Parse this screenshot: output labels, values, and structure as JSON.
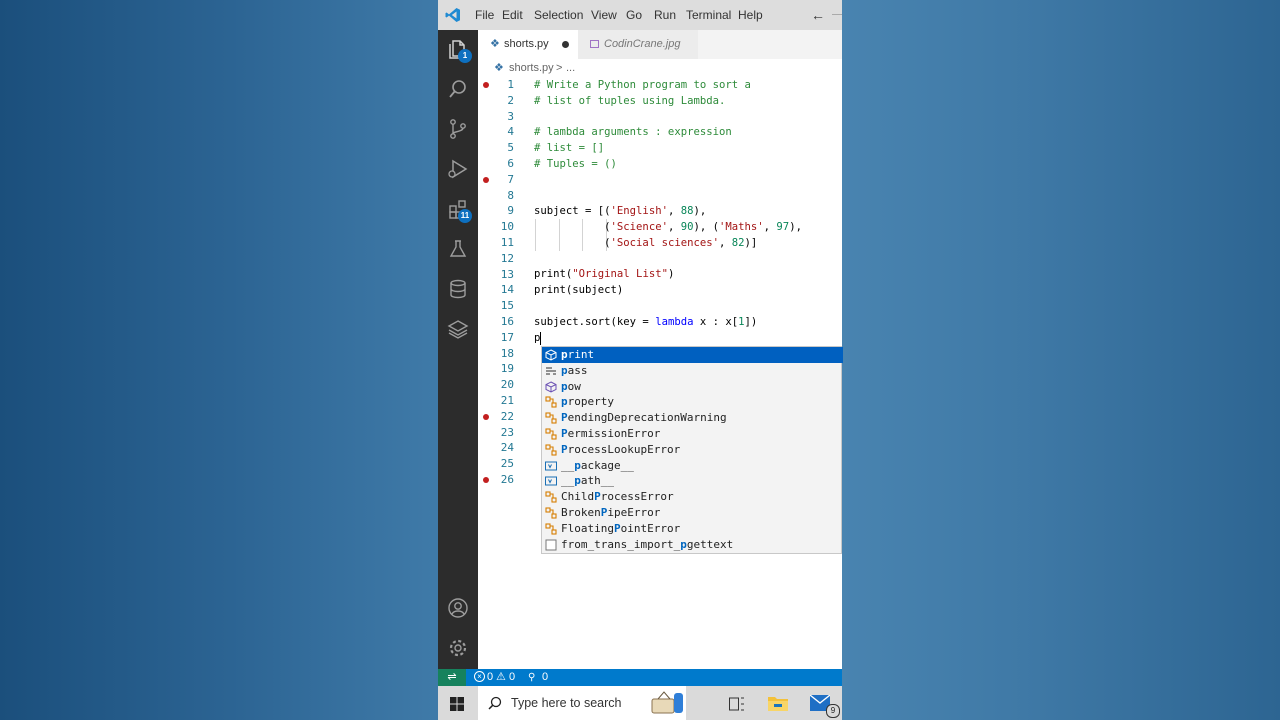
{
  "menu": {
    "items": [
      "File",
      "Edit",
      "Selection",
      "View",
      "Go",
      "Run",
      "Terminal",
      "Help"
    ],
    "back_arrow": "←"
  },
  "activity_bar": {
    "explorer_badge": "1",
    "extensions_badge": "11",
    "icons": [
      "files-icon",
      "search-icon",
      "source-control-icon",
      "run-debug-icon",
      "extensions-icon",
      "testing-icon",
      "database-icon",
      "layers-icon",
      "account-icon",
      "settings-gear-icon"
    ]
  },
  "tabs": [
    {
      "label": "shorts.py",
      "active": true,
      "modified": true
    },
    {
      "label": "CodinCrane.jpg",
      "active": false,
      "modified": false
    }
  ],
  "breadcrumb": {
    "file": "shorts.py",
    "sep": ">",
    "rest": "..."
  },
  "editor": {
    "line_numbers": [
      "1",
      "2",
      "3",
      "4",
      "5",
      "6",
      "7",
      "8",
      "9",
      "10",
      "11",
      "12",
      "13",
      "14",
      "15",
      "16",
      "17",
      "18",
      "19",
      "20",
      "21",
      "22",
      "23",
      "24",
      "25",
      "26"
    ],
    "breakpoint_lines": [
      1,
      7,
      22,
      26
    ],
    "code": {
      "l1": "# Write a Python program to sort a",
      "l2": "# list of tuples using Lambda.",
      "l4": "# lambda arguments : expression",
      "l5": "# list = []",
      "l6": "# Tuples = ()",
      "l9": [
        "subject = [(",
        "'English'",
        ", ",
        "88",
        "),"
      ],
      "l10": [
        "           (",
        "'Science'",
        ", ",
        "90",
        "), (",
        "'Maths'",
        ", ",
        "97",
        "),"
      ],
      "l11": [
        "           (",
        "'Social sciences'",
        ", ",
        "82",
        ")]"
      ],
      "l13": [
        "print(",
        "\"Original List\"",
        ")"
      ],
      "l14": "print(subject)",
      "l16": [
        "subject.sort(key = ",
        "lambda",
        " x : x[",
        "1",
        "])"
      ],
      "l17": "p"
    }
  },
  "suggestions": [
    {
      "pre": "",
      "hl": "p",
      "post": "rint",
      "icon": "cube-icon",
      "selected": true
    },
    {
      "pre": "",
      "hl": "p",
      "post": "ass",
      "icon": "keyword-icon",
      "selected": false
    },
    {
      "pre": "",
      "hl": "p",
      "post": "ow",
      "icon": "cube-icon",
      "selected": false
    },
    {
      "pre": "",
      "hl": "p",
      "post": "roperty",
      "icon": "class-icon",
      "selected": false
    },
    {
      "pre": "",
      "hl": "P",
      "post": "endingDeprecationWarning",
      "icon": "class-icon",
      "selected": false
    },
    {
      "pre": "",
      "hl": "P",
      "post": "ermissionError",
      "icon": "class-icon",
      "selected": false
    },
    {
      "pre": "",
      "hl": "P",
      "post": "rocessLookupError",
      "icon": "class-icon",
      "selected": false
    },
    {
      "pre": "__",
      "hl": "p",
      "post": "ackage__",
      "icon": "variable-icon",
      "selected": false
    },
    {
      "pre": "__",
      "hl": "p",
      "post": "ath__",
      "icon": "variable-icon",
      "selected": false
    },
    {
      "pre": "Child",
      "hl": "P",
      "post": "rocessError",
      "icon": "class-icon",
      "selected": false
    },
    {
      "pre": "Broken",
      "hl": "P",
      "post": "ipeError",
      "icon": "class-icon",
      "selected": false
    },
    {
      "pre": "Floating",
      "hl": "P",
      "post": "ointError",
      "icon": "class-icon",
      "selected": false
    },
    {
      "pre": "from_trans_import_",
      "hl": "p",
      "post": "gettext",
      "icon": "text-icon",
      "selected": false
    }
  ],
  "status_bar": {
    "errors": "0",
    "warnings": "0",
    "ports": "0"
  },
  "taskbar": {
    "search_placeholder": "Type here to search",
    "mail_badge": "9"
  },
  "colors": {
    "accent": "#007acc",
    "selection": "#0060c0",
    "breakpoint": "#c21f1f",
    "comment": "#2e8b3a",
    "string": "#a31515",
    "number": "#098658",
    "keyword": "#0000ff"
  }
}
